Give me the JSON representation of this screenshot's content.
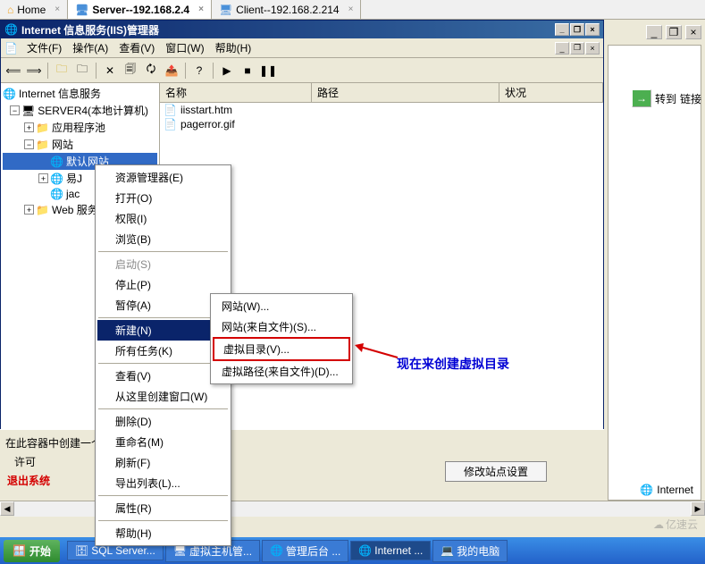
{
  "tabs": {
    "home": "Home",
    "server": "Server--192.168.2.4",
    "client": "Client--192.168.2.214"
  },
  "outer_toolbar": {
    "forward": "转到",
    "link": "链接"
  },
  "window": {
    "title": "Internet 信息服务(IIS)管理器"
  },
  "menubar": {
    "file": "文件(F)",
    "action": "操作(A)",
    "view": "查看(V)",
    "window": "窗口(W)",
    "help": "帮助(H)"
  },
  "tree": {
    "root": "Internet 信息服务",
    "server": "SERVER4(本地计算机)",
    "app_pool": "应用程序池",
    "websites": "网站",
    "site1": "默认网站",
    "site2": "易J",
    "site3": "jac",
    "webservice": "Web 服务"
  },
  "columns": {
    "name": "名称",
    "path": "路径",
    "status": "状况"
  },
  "files": {
    "f1": "iisstart.htm",
    "f2": "pagerror.gif"
  },
  "context_menu": {
    "explorer": "资源管理器(E)",
    "open": "打开(O)",
    "permissions": "权限(I)",
    "browse": "浏览(B)",
    "start": "启动(S)",
    "stop": "停止(P)",
    "pause": "暂停(A)",
    "new": "新建(N)",
    "all_tasks": "所有任务(K)",
    "view": "查看(V)",
    "new_window": "从这里创建窗口(W)",
    "delete": "删除(D)",
    "rename": "重命名(M)",
    "refresh": "刷新(F)",
    "export": "导出列表(L)...",
    "properties": "属性(R)",
    "help": "帮助(H)"
  },
  "submenu": {
    "website": "网站(W)...",
    "website_file": "网站(来自文件)(S)...",
    "vdir": "虚拟目录(V)...",
    "vpath": "虚拟路径(来自文件)(D)..."
  },
  "annotation": "现在来创建虚拟目录",
  "status": {
    "line1": "在此容器中创建一个",
    "line2": "许可",
    "line3": "退出系统",
    "box": "修改站点设置"
  },
  "right_pane": "Internet",
  "taskbar": {
    "start": "开始",
    "sql": "SQL Server...",
    "vhost": "虚拟主机管...",
    "admin": "管理后台 ...",
    "iis": "Internet ...",
    "mycomputer": "我的电脑"
  },
  "watermark": "亿速云"
}
